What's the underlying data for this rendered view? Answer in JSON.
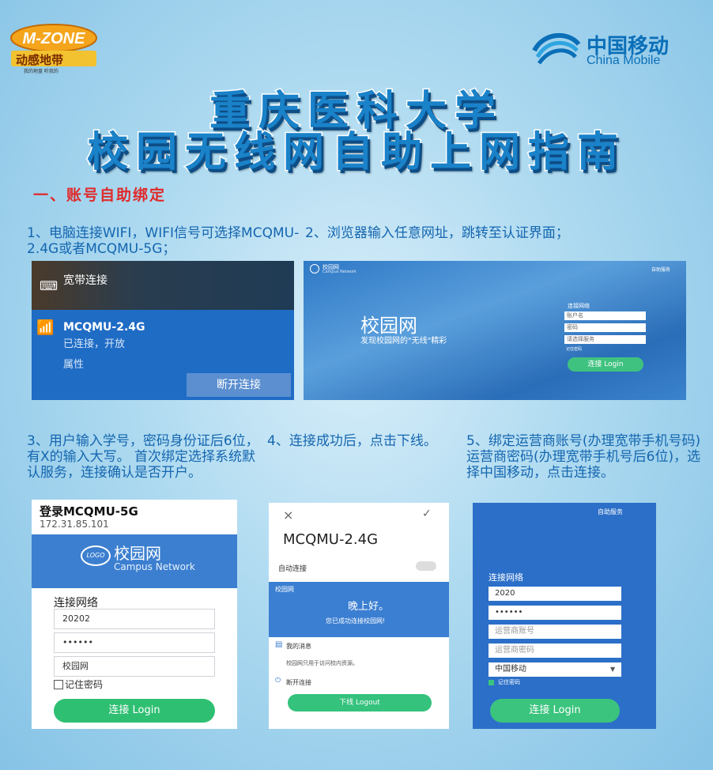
{
  "brand": {
    "mzone_logo": "M-ZONE",
    "mzone_sub": "动感地带",
    "mzone_tag": "我的地盘 听我的",
    "cm_cn": "中国移动",
    "cm_en": "China Mobile"
  },
  "title_line1": "重庆医科大学",
  "title_line2": "校园无线网自助上网指南",
  "section_title": "一、账号自助绑定",
  "steps": {
    "s1": "1、电脑连接WIFI，WIFI信号可选择MCQMU-2.4G或者MCQMU-5G；",
    "s2": "2、浏览器输入任意网址，跳转至认证界面；",
    "s3": "3、用户输入学号，密码身份证后6位，有X的输入大写。 首次绑定选择系统默认服务，连接确认是否开户。",
    "s4": "4、连接成功后，点击下线。",
    "s5": "5、绑定运营商账号(办理宽带手机号码)运营商密码(办理宽带手机号后6位)，选择中国移动，点击连接。"
  },
  "panel1": {
    "broadband": "宽带连接",
    "ssid": "MCQMU-2.4G",
    "status": "已连接，开放",
    "props": "属性",
    "disconnect": "断开连接"
  },
  "panel2": {
    "brand": "校园网",
    "brand_en": "Campus Network",
    "top_right": "自助服务",
    "hero": "校园网",
    "hero_sub": "发现校园网的\"无线\"精彩",
    "form_title": "连接网络",
    "field_user": "账户名",
    "field_pwd": "密码",
    "field_service": "请选择服务",
    "remember": "记住密码",
    "login": "连接 Login"
  },
  "panel3": {
    "title": "登录MCQMU-5G",
    "ip": "172.31.85.101",
    "logo": "LOGO",
    "brand": "校园网",
    "brand_en": "Campus Network",
    "form_title": "连接网络",
    "user_value": "20202",
    "pwd_value": "••••••",
    "service_value": "校园网",
    "remember": "记住密码",
    "login": "连接 Login"
  },
  "panel4": {
    "close": "×",
    "check": "✓",
    "ssid": "MCQMU-2.4G",
    "auto": "自动连接",
    "campus": "校园网",
    "greeting": "晚上好。",
    "success": "您已成功连接校园网!",
    "msg_title": "我的消息",
    "msg_body": "校园网只用于访问校内资源。",
    "disconnect": "断开连接",
    "logout": "下线 Logout"
  },
  "panel5": {
    "top_right": "自助服务",
    "form_title": "连接网络",
    "user_value": "2020",
    "pwd_value": "••••••",
    "isp_user_ph": "运营商账号",
    "isp_pwd_ph": "运营商密码",
    "isp_value": "中国移动",
    "remember": "记住密码",
    "login": "连接 Login"
  },
  "colors": {
    "title_blue": "#1a82c9",
    "section_red": "#e02a2a",
    "step_blue": "#1466b0",
    "green_button": "#2fbf72"
  }
}
